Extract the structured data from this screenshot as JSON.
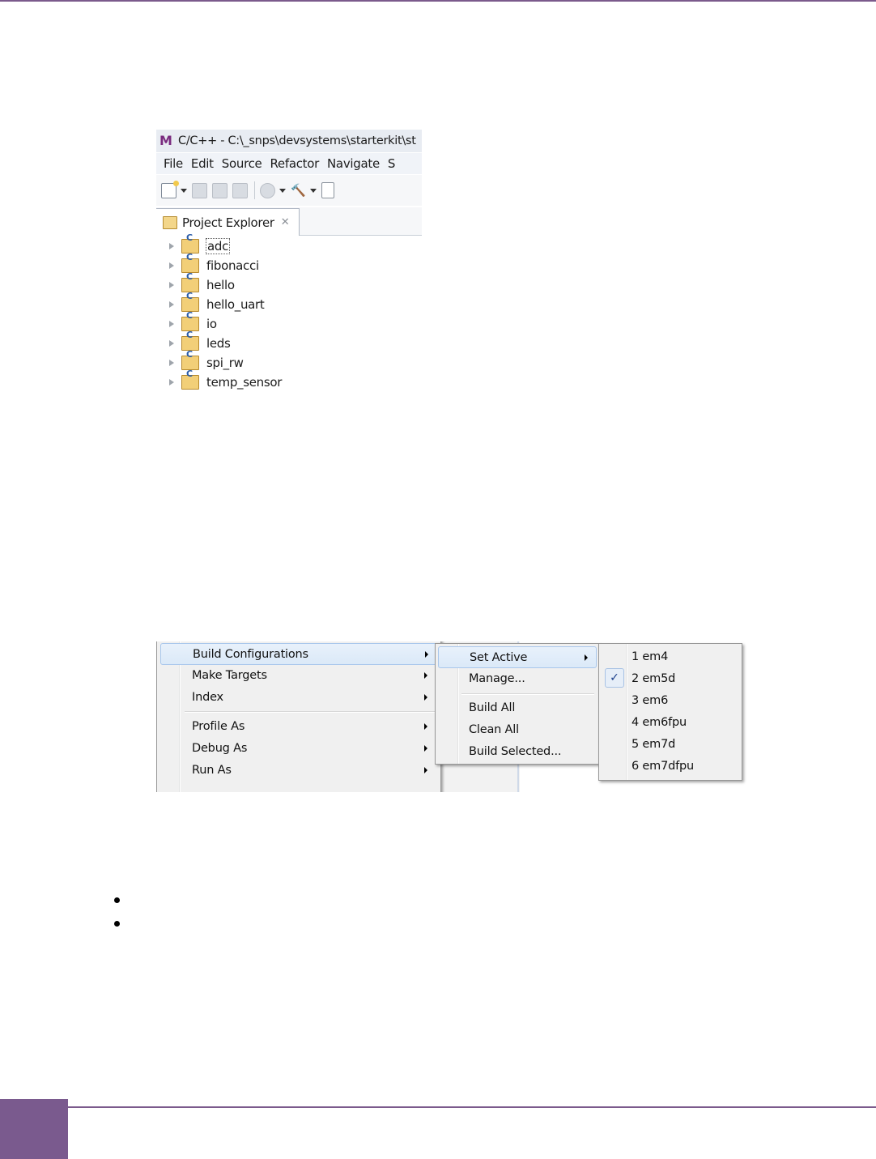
{
  "ide": {
    "window_title": "C/C++ - C:\\_snps\\devsystems\\starterkit\\st",
    "logo_letter": "M",
    "menubar": [
      "File",
      "Edit",
      "Source",
      "Refactor",
      "Navigate",
      "S"
    ],
    "panel_tab": "Project Explorer",
    "panel_close_glyph": "✕",
    "projects": [
      "adc",
      "fibonacci",
      "hello",
      "hello_uart",
      "io",
      "leds",
      "spi_rw",
      "temp_sensor"
    ],
    "selected_project": "adc"
  },
  "context_menu": {
    "main": [
      {
        "label": "Build Configurations",
        "submenu": true,
        "highlighted": true
      },
      {
        "label": "Make Targets",
        "submenu": true
      },
      {
        "label": "Index",
        "submenu": true
      },
      {
        "label": "Profile As",
        "submenu": true
      },
      {
        "label": "Debug As",
        "submenu": true
      },
      {
        "label": "Run As",
        "submenu": true
      }
    ],
    "build_configurations": [
      {
        "label": "Set Active",
        "submenu": true,
        "highlighted": true
      },
      {
        "label": "Manage..."
      },
      {
        "label": "Build All"
      },
      {
        "label": "Clean All"
      },
      {
        "label": "Build Selected..."
      }
    ],
    "set_active": [
      {
        "label": "1 em4",
        "checked": false
      },
      {
        "label": "2 em5d",
        "checked": true
      },
      {
        "label": "3 em6",
        "checked": false
      },
      {
        "label": "4 em6fpu",
        "checked": false
      },
      {
        "label": "5 em7d",
        "checked": false
      },
      {
        "label": "6 em7dfpu",
        "checked": false
      }
    ],
    "check_glyph": "✓"
  },
  "colors": {
    "accent_purple": "#7a5a8e",
    "menu_highlight": "#dbe9f8"
  }
}
